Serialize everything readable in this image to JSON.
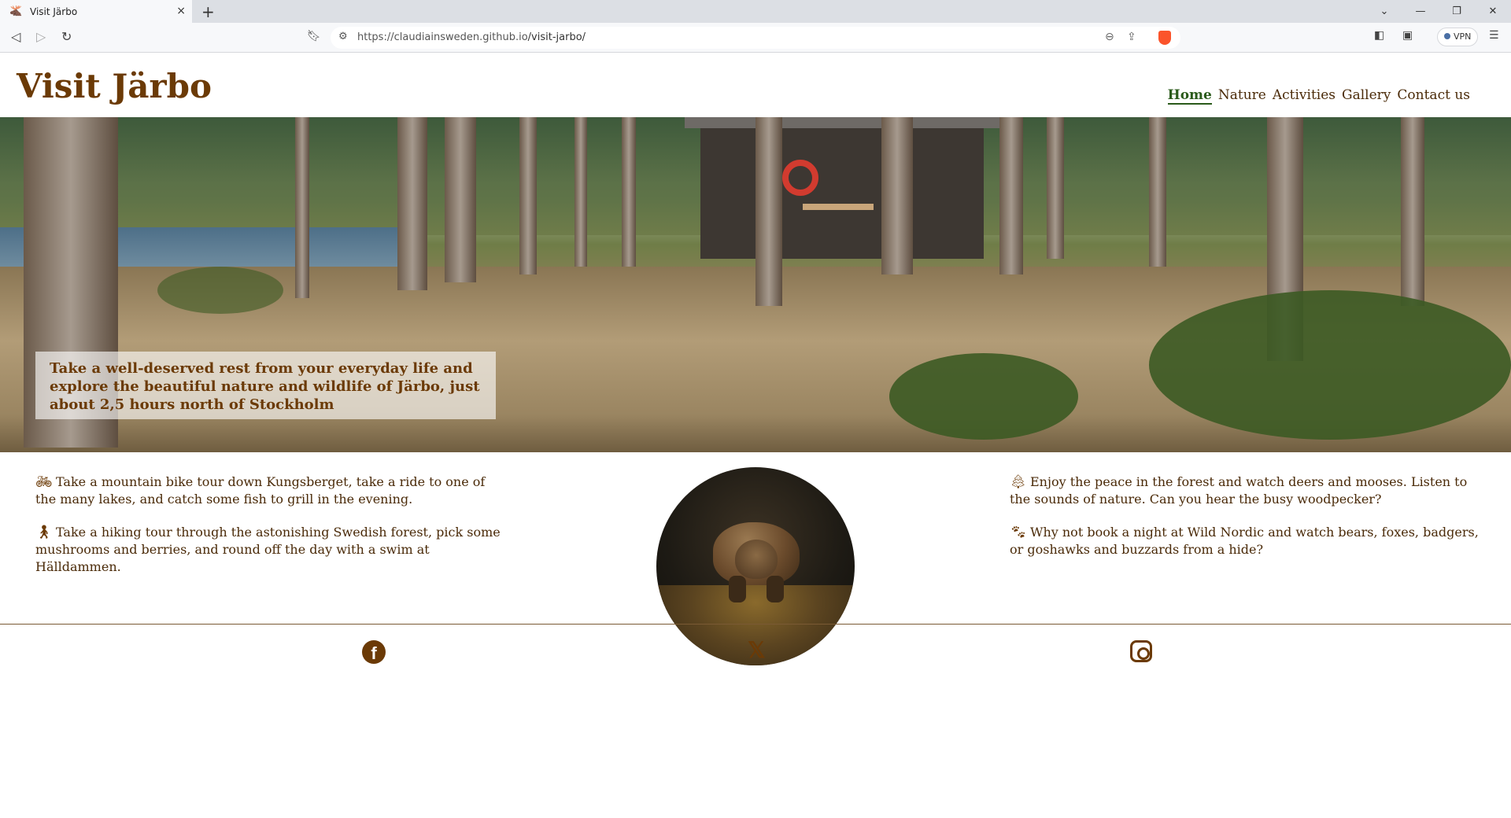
{
  "browser": {
    "tab_title": "Visit Järbo",
    "tab_close": "×",
    "new_tab": "+",
    "url_host": "https://claudiainsweden.github.io",
    "url_path": "/visit-jarbo/",
    "vpn_label": "VPN",
    "window_controls": [
      "⌄",
      "—",
      "❐",
      "✕"
    ]
  },
  "site": {
    "brand": "Visit Järbo",
    "nav": [
      {
        "label": "Home",
        "active": true
      },
      {
        "label": "Nature",
        "active": false
      },
      {
        "label": "Activities",
        "active": false
      },
      {
        "label": "Gallery",
        "active": false
      },
      {
        "label": "Contact us",
        "active": false
      }
    ],
    "hero_caption": "Take a well-deserved rest from your everyday life and explore the beautiful nature and wildlife of Järbo, just about 2,5 hours north of Stockholm"
  },
  "features": {
    "left": [
      {
        "icon": "bicycle-icon",
        "text": "Take a mountain bike tour down Kungsberget, take a ride to one of the many lakes, and catch some fish to grill in the evening."
      },
      {
        "icon": "hiking-icon",
        "text": "Take a hiking tour through the astonishing Swedish forest, pick some mushrooms and berries, and round off the day with a swim at Hälldammen."
      }
    ],
    "right": [
      {
        "icon": "tree-icon",
        "text": "Enjoy the peace in the forest and watch deers and mooses. Listen to the sounds of nature. Can you hear the busy woodpecker?"
      },
      {
        "icon": "paw-icon",
        "text": "Why not book a night at Wild Nordic and watch bears, foxes, badgers, or goshawks and buzzards from a hide?"
      }
    ]
  },
  "footer": {
    "social": [
      {
        "icon": "facebook-icon"
      },
      {
        "icon": "x-twitter-icon"
      },
      {
        "icon": "instagram-icon"
      }
    ]
  },
  "colors": {
    "brand_brown": "#6b3a06",
    "nav_active_green": "#2a5a1a",
    "text_brown": "#4a2a08"
  }
}
